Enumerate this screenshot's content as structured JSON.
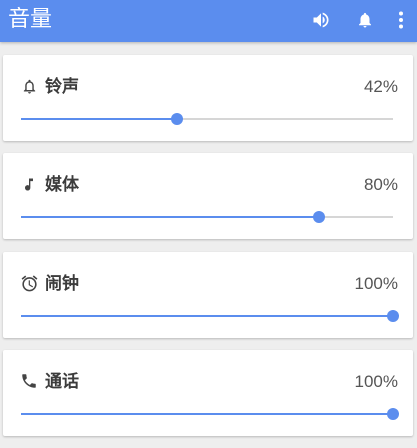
{
  "appbar": {
    "title": "音量",
    "actions": [
      {
        "name": "speaker-icon"
      },
      {
        "name": "bell-icon"
      },
      {
        "name": "more-vert-icon"
      }
    ]
  },
  "colors": {
    "accent": "#5b8dee",
    "track": "#d6d6d6",
    "text": "#3c3c3c"
  },
  "volumes": [
    {
      "key": "ringtone",
      "icon": "bell-icon",
      "label": "铃声",
      "value_text": "42%",
      "level": 0.42
    },
    {
      "key": "media",
      "icon": "music-note-icon",
      "label": "媒体",
      "value_text": "80%",
      "level": 0.8
    },
    {
      "key": "alarm",
      "icon": "alarm-clock-icon",
      "label": "闹钟",
      "value_text": "100%",
      "level": 1.0
    },
    {
      "key": "call",
      "icon": "phone-icon",
      "label": "通话",
      "value_text": "100%",
      "level": 1.0
    }
  ]
}
